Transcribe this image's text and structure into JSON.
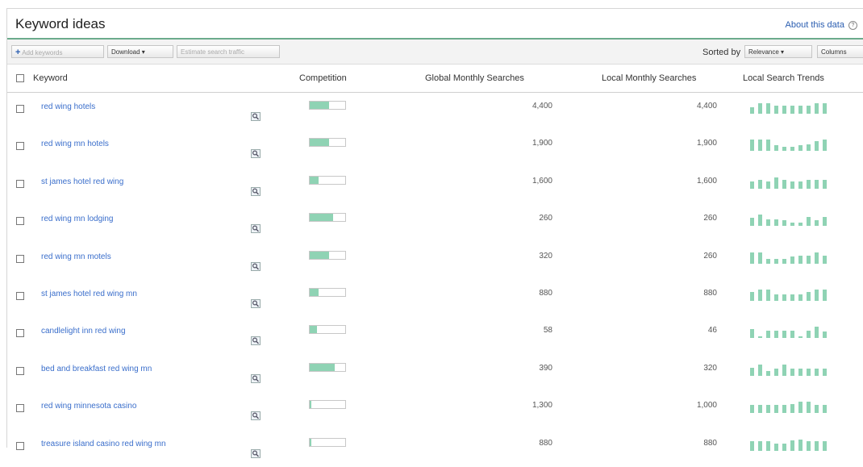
{
  "header": {
    "title": "Keyword ideas",
    "about_label": "About this data",
    "help_glyph": "?"
  },
  "toolbar": {
    "add_keywords": "Add keywords",
    "download": "Download ▾",
    "estimate": "Estimate search traffic",
    "sorted_by": "Sorted by",
    "sort_value": "Relevance ▾",
    "columns": "Columns"
  },
  "columns": {
    "keyword": "Keyword",
    "competition": "Competition",
    "global": "Global Monthly Searches",
    "local": "Local Monthly Searches",
    "trends": "Local Search Trends"
  },
  "colors": {
    "accent_green": "#8fd3b4",
    "link_blue": "#3a6ecb",
    "rule_green": "#6bab8c"
  },
  "rows": [
    {
      "keyword": "red wing hotels",
      "competition": 0.55,
      "global": "4,400",
      "local": "4,400",
      "trend": [
        0.6,
        0.9,
        0.9,
        0.7,
        0.7,
        0.7,
        0.7,
        0.7,
        0.9,
        0.9
      ]
    },
    {
      "keyword": "red wing mn hotels",
      "competition": 0.55,
      "global": "1,900",
      "local": "1,900",
      "trend": [
        1,
        1,
        1,
        0.5,
        0.4,
        0.4,
        0.5,
        0.6,
        0.9,
        1
      ]
    },
    {
      "keyword": "st james hotel red wing",
      "competition": 0.25,
      "global": "1,600",
      "local": "1,600",
      "trend": [
        0.6,
        0.8,
        0.6,
        1,
        0.8,
        0.6,
        0.6,
        0.8,
        0.8,
        0.8
      ]
    },
    {
      "keyword": "red wing mn lodging",
      "competition": 0.65,
      "global": "260",
      "local": "260",
      "trend": [
        0.7,
        1,
        0.6,
        0.6,
        0.5,
        0.3,
        0.3,
        0.8,
        0.5,
        0.8
      ]
    },
    {
      "keyword": "red wing mn motels",
      "competition": 0.55,
      "global": "320",
      "local": "260",
      "trend": [
        1,
        1,
        0.4,
        0.4,
        0.4,
        0.6,
        0.7,
        0.7,
        1,
        0.7
      ]
    },
    {
      "keyword": "st james hotel red wing mn",
      "competition": 0.25,
      "global": "880",
      "local": "880",
      "trend": [
        0.8,
        1,
        1,
        0.6,
        0.6,
        0.6,
        0.6,
        0.8,
        1,
        1
      ]
    },
    {
      "keyword": "candlelight inn red wing",
      "competition": 0.2,
      "global": "58",
      "local": "46",
      "trend": [
        0.8,
        0.2,
        0.7,
        0.7,
        0.7,
        0.7,
        0.2,
        0.7,
        1,
        0.6
      ]
    },
    {
      "keyword": "bed and breakfast red wing mn",
      "competition": 0.7,
      "global": "390",
      "local": "320",
      "trend": [
        0.7,
        1,
        0.4,
        0.6,
        1,
        0.6,
        0.6,
        0.6,
        0.6,
        0.6
      ]
    },
    {
      "keyword": "red wing minnesota casino",
      "competition": 0.05,
      "global": "1,300",
      "local": "1,000",
      "trend": [
        0.7,
        0.7,
        0.7,
        0.7,
        0.7,
        0.8,
        1,
        1,
        0.7,
        0.7
      ]
    },
    {
      "keyword": "treasure island casino red wing mn",
      "competition": 0.05,
      "global": "880",
      "local": "880",
      "trend": [
        0.8,
        0.8,
        0.8,
        0.6,
        0.6,
        0.9,
        1,
        0.8,
        0.8,
        0.8
      ]
    }
  ]
}
